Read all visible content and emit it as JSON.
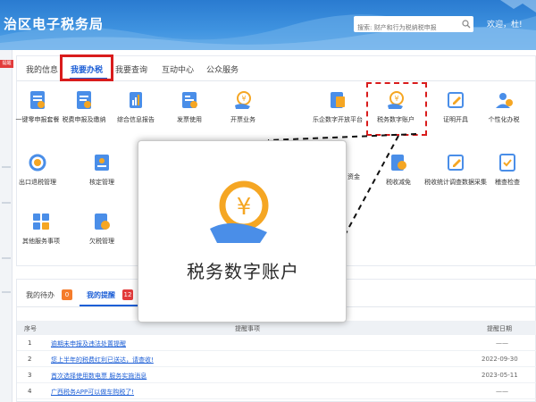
{
  "header": {
    "title": "治区电子税务局",
    "search_placeholder": "搜索: 财产和行为税纳税申报",
    "welcome": "欢迎，杜!"
  },
  "left_strip": {
    "badge": "提醒"
  },
  "tabs": [
    {
      "label": "我的信息",
      "active": false
    },
    {
      "label": "我要办税",
      "active": true
    },
    {
      "label": "我要查询",
      "active": false
    },
    {
      "label": "互动中心",
      "active": false
    },
    {
      "label": "公众服务",
      "active": false
    }
  ],
  "services_row1": [
    {
      "label": "一键零申报套餐",
      "icon": "document-icon"
    },
    {
      "label": "税费申报及缴纳",
      "icon": "document-icon"
    },
    {
      "label": "综合信息报告",
      "icon": "report-icon"
    },
    {
      "label": "发票使用",
      "icon": "invoice-icon"
    },
    {
      "label": "开票业务",
      "icon": "yuan-hand-icon"
    },
    {
      "label": "乐企数字开放平台",
      "icon": "platform-icon"
    },
    {
      "label": "税务数字账户",
      "icon": "yuan-hand-icon"
    },
    {
      "label": "证明开具",
      "icon": "edit-icon"
    },
    {
      "label": "个性化办税",
      "icon": "person-gear-icon"
    }
  ],
  "services_row2": [
    {
      "label": "出口退税管理",
      "icon": "refresh-yuan-icon"
    },
    {
      "label": "核定管理",
      "icon": "user-doc-icon"
    },
    {
      "label": "资金",
      "icon": "coin-icon"
    },
    {
      "label": "税收减免",
      "icon": "tax-relief-icon"
    },
    {
      "label": "税收统计调查数据采集",
      "icon": "edit-icon"
    },
    {
      "label": "稽查检查",
      "icon": "check-doc-icon"
    }
  ],
  "services_row3": [
    {
      "label": "其他服务事项",
      "icon": "grid-icon"
    },
    {
      "label": "欠税管理",
      "icon": "doc-yuan-icon"
    }
  ],
  "zoom": {
    "label": "税务数字账户",
    "icon": "yuan-hand-icon"
  },
  "reminders": {
    "tabs": [
      {
        "label": "我的待办",
        "count": "0"
      },
      {
        "label": "我的提醒",
        "count": "12"
      }
    ],
    "columns": [
      "序号",
      "提醒事项",
      "提醒日期"
    ],
    "rows": [
      {
        "no": "1",
        "item": "逾期未申报及违法处置提醒",
        "date": "——"
      },
      {
        "no": "2",
        "item": "您上半年的税费红利已送达，请查收!",
        "date": "2022-09-30"
      },
      {
        "no": "3",
        "item": "首次选择使用数电票 服务实施消息",
        "date": "2023-05-11"
      },
      {
        "no": "4",
        "item": "广西税务APP可以做车购税了!",
        "date": "——"
      }
    ]
  },
  "colors": {
    "accent": "#1d5fd6",
    "highlight": "#d91c1c",
    "header": "#2a7bd0",
    "icon_blue": "#4a8ee8",
    "icon_orange": "#f5a623"
  }
}
